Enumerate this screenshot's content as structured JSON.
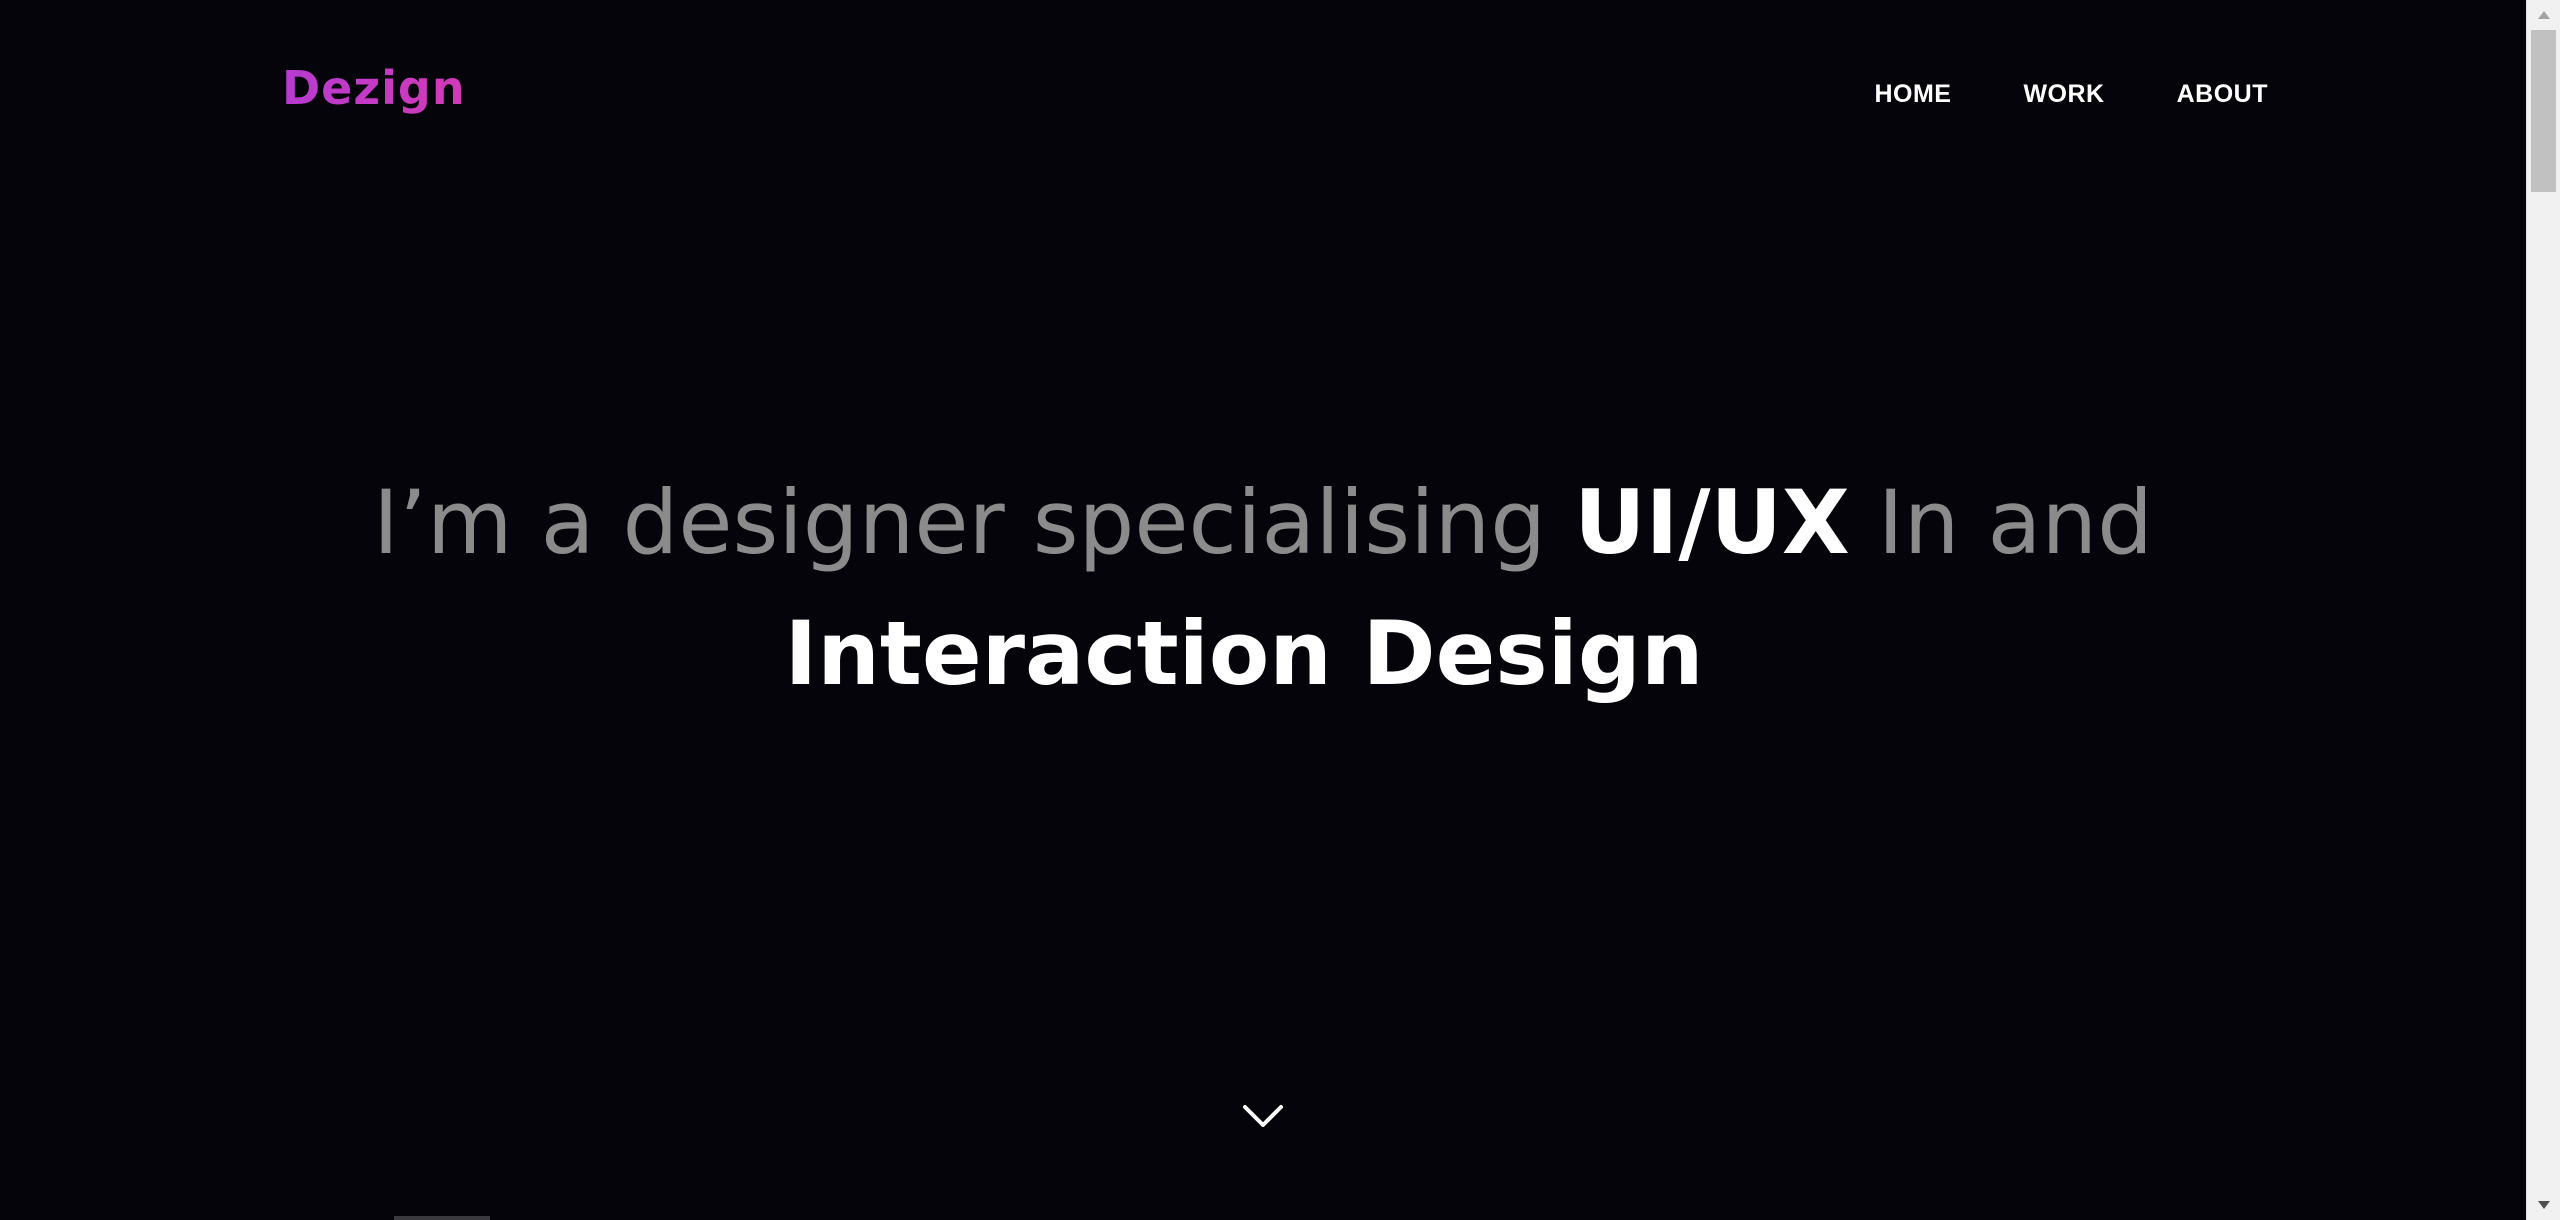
{
  "brand": {
    "logo_text": "Dezign",
    "accent_color": "#c23ec9"
  },
  "nav": {
    "items": [
      {
        "label": "HOME"
      },
      {
        "label": "WORK"
      },
      {
        "label": "ABOUT"
      }
    ]
  },
  "hero": {
    "line1_part1": "I’m a designer specialising ",
    "line1_highlight": "UI/UX",
    "line1_part2": " In and",
    "line2": "Interaction Design"
  },
  "scroll": {
    "icon": "chevron-down-icon"
  },
  "colors": {
    "background": "#04040a",
    "text_primary": "#ffffff",
    "text_muted": "#8a8a8a"
  }
}
